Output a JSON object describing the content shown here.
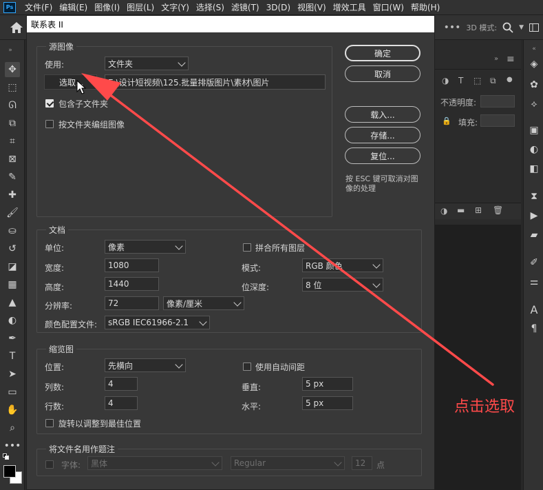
{
  "menubar": {
    "logo": "Ps",
    "items": [
      "文件(F)",
      "编辑(E)",
      "图像(I)",
      "图层(L)",
      "文字(Y)",
      "选择(S)",
      "滤镜(T)",
      "3D(D)",
      "视图(V)",
      "增效工具",
      "窗口(W)",
      "帮助(H)"
    ]
  },
  "optionsbar": {
    "mode_3d": "3D 模式:"
  },
  "right_panel": {
    "opacity_label": "不透明度:",
    "fill_label": "填充:"
  },
  "dialog": {
    "title": "联系表 II",
    "source": {
      "group_title": "源图像",
      "use_label": "使用:",
      "use_value": "文件夹",
      "browse_label": "选取...",
      "path": "E:\\设计短视频\\125.批量排版图片\\素材\\图片",
      "include_subfolders_label": "包含子文件夹",
      "include_subfolders_checked": true,
      "group_by_folder_label": "按文件夹编组图像",
      "group_by_folder_checked": false
    },
    "buttons": {
      "ok": "确定",
      "cancel": "取消",
      "load": "载入...",
      "save": "存储...",
      "reset": "复位..."
    },
    "esc_hint": "按 ESC 键可取消对图像的处理",
    "document": {
      "group_title": "文档",
      "units_label": "单位:",
      "units_value": "像素",
      "width_label": "宽度:",
      "width_value": "1080",
      "height_label": "高度:",
      "height_value": "1440",
      "resolution_label": "分辨率:",
      "resolution_value": "72",
      "resolution_unit": "像素/厘米",
      "profile_label": "颜色配置文件:",
      "profile_value": "sRGB IEC61966-2.1",
      "flatten_label": "拼合所有图层",
      "flatten_checked": false,
      "mode_label": "模式:",
      "mode_value": "RGB 颜色",
      "bitdepth_label": "位深度:",
      "bitdepth_value": "8 位"
    },
    "thumbnails": {
      "group_title": "缩览图",
      "place_label": "位置:",
      "place_value": "先横向",
      "columns_label": "列数:",
      "columns_value": "4",
      "rows_label": "行数:",
      "rows_value": "4",
      "auto_spacing_label": "使用自动间距",
      "auto_spacing_checked": false,
      "vertical_label": "垂直:",
      "vertical_value": "5 px",
      "horizontal_label": "水平:",
      "horizontal_value": "5 px",
      "rotate_label": "旋转以调整到最佳位置",
      "rotate_checked": false
    },
    "caption": {
      "group_title": "将文件名用作题注",
      "font_label": "字体:",
      "font_value": "黑体",
      "style_value": "Regular",
      "size_value": "12",
      "size_unit": "点"
    }
  },
  "annotation": {
    "text": "点击选取",
    "color": "#ff4a4a"
  }
}
